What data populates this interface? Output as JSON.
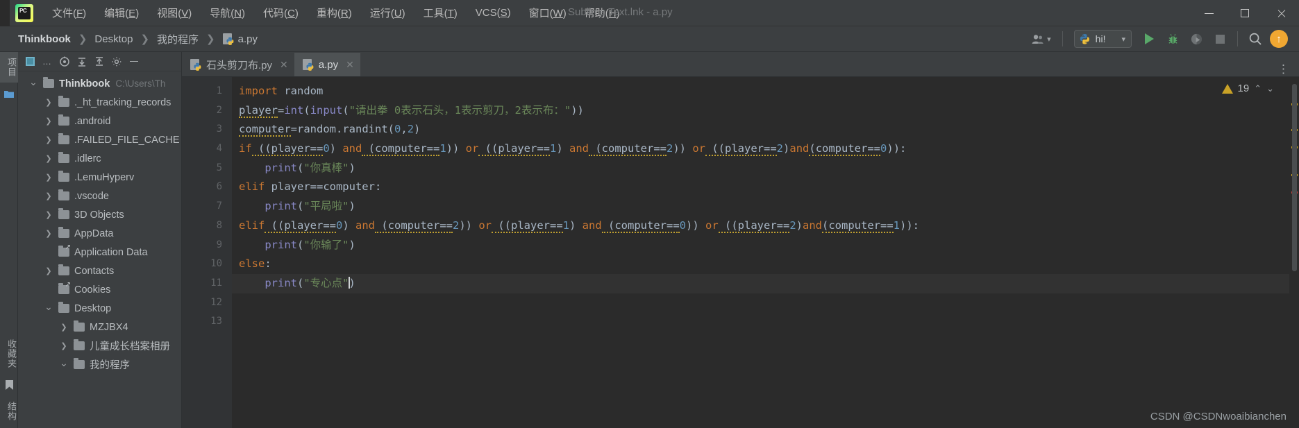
{
  "window": {
    "title": "Sublime Text.lnk - a.py",
    "app_icon": "pycharm-logo",
    "controls": {
      "minimize": "–",
      "maximize": "□",
      "close": "✕"
    }
  },
  "menubar": {
    "items": [
      {
        "label": "文件",
        "mnemonic": "F"
      },
      {
        "label": "编辑",
        "mnemonic": "E"
      },
      {
        "label": "视图",
        "mnemonic": "V"
      },
      {
        "label": "导航",
        "mnemonic": "N"
      },
      {
        "label": "代码",
        "mnemonic": "C"
      },
      {
        "label": "重构",
        "mnemonic": "R"
      },
      {
        "label": "运行",
        "mnemonic": "U"
      },
      {
        "label": "工具",
        "mnemonic": "T"
      },
      {
        "label": "VCS",
        "mnemonic": "S"
      },
      {
        "label": "窗口",
        "mnemonic": "W"
      },
      {
        "label": "帮助",
        "mnemonic": "H"
      }
    ]
  },
  "navbar": {
    "breadcrumb": [
      {
        "label": "Thinkbook",
        "root": true
      },
      {
        "label": "Desktop",
        "root": false
      },
      {
        "label": "我的程序",
        "root": false
      },
      {
        "label": "a.py",
        "root": false,
        "icon": "python-file-icon"
      }
    ],
    "separator": "❯",
    "user_icon": "user-avatar-icon",
    "user_chevron": "▾",
    "run_config": {
      "label": "hi!",
      "icon": "python-icon",
      "chevron": "▾"
    },
    "actions": [
      {
        "name": "run-button",
        "icon": "play-icon"
      },
      {
        "name": "debug-button",
        "icon": "bug-icon"
      },
      {
        "name": "coverage-button",
        "icon": "coverage-icon"
      },
      {
        "name": "stop-button",
        "icon": "stop-icon"
      },
      {
        "name": "search-button",
        "icon": "search-icon"
      },
      {
        "name": "update-button",
        "icon": "arrow-up-icon"
      }
    ]
  },
  "toolstrip": {
    "top_label": "项目",
    "bottom_labels": [
      "收藏夹",
      "结构"
    ],
    "icons": [
      "project-icon",
      "bookmark-icon"
    ]
  },
  "project_panel": {
    "toolbar": [
      {
        "name": "project-view-selector",
        "icon": "square-icon"
      },
      {
        "name": "view-options",
        "icon": "ellipsis-icon"
      },
      {
        "name": "locate-icon",
        "icon": "target-icon"
      },
      {
        "name": "expand-all-icon",
        "icon": "expand-icon"
      },
      {
        "name": "collapse-all-icon",
        "icon": "collapse-icon"
      },
      {
        "name": "settings-icon",
        "icon": "gear-icon"
      },
      {
        "name": "hide-panel-icon",
        "icon": "minus-icon"
      }
    ],
    "tree": [
      {
        "label": "Thinkbook",
        "path": "C:\\Users\\Th",
        "indent": 0,
        "twisty": "expanded",
        "bold": true,
        "link": false
      },
      {
        "label": "._ht_tracking_records",
        "indent": 1,
        "twisty": "collapsed",
        "bold": false,
        "link": false
      },
      {
        "label": ".android",
        "indent": 1,
        "twisty": "collapsed",
        "bold": false,
        "link": false
      },
      {
        "label": ".FAILED_FILE_CACHE",
        "indent": 1,
        "twisty": "collapsed",
        "bold": false,
        "link": false
      },
      {
        "label": ".idlerc",
        "indent": 1,
        "twisty": "collapsed",
        "bold": false,
        "link": false
      },
      {
        "label": ".LemuHyperv",
        "indent": 1,
        "twisty": "collapsed",
        "bold": false,
        "link": false
      },
      {
        "label": ".vscode",
        "indent": 1,
        "twisty": "collapsed",
        "bold": false,
        "link": false
      },
      {
        "label": "3D Objects",
        "indent": 1,
        "twisty": "collapsed",
        "bold": false,
        "link": false
      },
      {
        "label": "AppData",
        "indent": 1,
        "twisty": "collapsed",
        "bold": false,
        "link": false
      },
      {
        "label": "Application Data",
        "indent": 1,
        "twisty": "none",
        "bold": false,
        "link": true
      },
      {
        "label": "Contacts",
        "indent": 1,
        "twisty": "collapsed",
        "bold": false,
        "link": false
      },
      {
        "label": "Cookies",
        "indent": 1,
        "twisty": "none",
        "bold": false,
        "link": true
      },
      {
        "label": "Desktop",
        "indent": 1,
        "twisty": "expanded",
        "bold": false,
        "link": false
      },
      {
        "label": "MZJBX4",
        "indent": 2,
        "twisty": "collapsed",
        "bold": false,
        "link": false
      },
      {
        "label": "儿童成长档案相册",
        "indent": 2,
        "twisty": "collapsed",
        "bold": false,
        "link": false
      },
      {
        "label": "我的程序",
        "indent": 2,
        "twisty": "expanded",
        "bold": false,
        "link": false
      }
    ]
  },
  "tabs": {
    "items": [
      {
        "label": "石头剪刀布.py",
        "active": false,
        "icon": "python-file-icon",
        "close": "✕"
      },
      {
        "label": "a.py",
        "active": true,
        "icon": "python-file-icon",
        "close": "✕"
      }
    ],
    "overflow_icon": "more-vertical-icon"
  },
  "editor": {
    "line_numbers": [
      "1",
      "2",
      "3",
      "4",
      "5",
      "6",
      "7",
      "8",
      "9",
      "10",
      "11",
      "12",
      "13"
    ],
    "caret_line": 11,
    "inspection": {
      "count": "19",
      "icon": "warning-triangle-icon",
      "up": "⌃",
      "down": "⌄"
    },
    "lines": [
      {
        "n": 1,
        "tokens": [
          {
            "t": "import",
            "c": "k-kw"
          },
          {
            "t": " random",
            "c": "k-id"
          }
        ]
      },
      {
        "n": 2,
        "tokens": [
          {
            "t": "player",
            "c": "k-id"
          },
          {
            "t": "=",
            "c": "k-id"
          },
          {
            "t": "int",
            "c": "k-fn"
          },
          {
            "t": "(",
            "c": "k-id"
          },
          {
            "t": "input",
            "c": "k-fn"
          },
          {
            "t": "(",
            "c": "k-id"
          },
          {
            "t": "\"请出拳 0表示石头，1表示剪刀，2表示布：\"",
            "c": "k-str"
          },
          {
            "t": "))",
            "c": "k-id"
          }
        ]
      },
      {
        "n": 3,
        "tokens": [
          {
            "t": "computer",
            "c": "k-id"
          },
          {
            "t": "=",
            "c": "k-id"
          },
          {
            "t": "random",
            "c": "k-id"
          },
          {
            "t": ".randint(",
            "c": "k-id"
          },
          {
            "t": "0",
            "c": "k-num"
          },
          {
            "t": ",",
            "c": "k-id"
          },
          {
            "t": "2",
            "c": "k-num"
          },
          {
            "t": ")",
            "c": "k-id"
          }
        ]
      },
      {
        "n": 4,
        "tokens": [
          {
            "t": "if",
            "c": "k-kw"
          },
          {
            "t": " ((player==",
            "c": "k-id"
          },
          {
            "t": "0",
            "c": "k-num"
          },
          {
            "t": ") ",
            "c": "k-id"
          },
          {
            "t": "and",
            "c": "k-kw"
          },
          {
            "t": " (computer==",
            "c": "k-id"
          },
          {
            "t": "1",
            "c": "k-num"
          },
          {
            "t": ")) ",
            "c": "k-id"
          },
          {
            "t": "or",
            "c": "k-kw"
          },
          {
            "t": " ((player==",
            "c": "k-id"
          },
          {
            "t": "1",
            "c": "k-num"
          },
          {
            "t": ") ",
            "c": "k-id"
          },
          {
            "t": "and",
            "c": "k-kw"
          },
          {
            "t": " (computer==",
            "c": "k-id"
          },
          {
            "t": "2",
            "c": "k-num"
          },
          {
            "t": ")) ",
            "c": "k-id"
          },
          {
            "t": "or",
            "c": "k-kw"
          },
          {
            "t": " ((player==",
            "c": "k-id"
          },
          {
            "t": "2",
            "c": "k-num"
          },
          {
            "t": ")",
            "c": "k-id"
          },
          {
            "t": "and",
            "c": "k-kw"
          },
          {
            "t": "(computer==",
            "c": "k-id"
          },
          {
            "t": "0",
            "c": "k-num"
          },
          {
            "t": ")):",
            "c": "k-id"
          }
        ]
      },
      {
        "n": 5,
        "tokens": [
          {
            "t": "    ",
            "c": "k-id"
          },
          {
            "t": "print",
            "c": "k-fn"
          },
          {
            "t": "(",
            "c": "k-id"
          },
          {
            "t": "\"你真棒\"",
            "c": "k-str"
          },
          {
            "t": ")",
            "c": "k-id"
          }
        ]
      },
      {
        "n": 6,
        "tokens": [
          {
            "t": "elif",
            "c": "k-kw"
          },
          {
            "t": " player==computer:",
            "c": "k-id"
          }
        ]
      },
      {
        "n": 7,
        "tokens": [
          {
            "t": "    ",
            "c": "k-id"
          },
          {
            "t": "print",
            "c": "k-fn"
          },
          {
            "t": "(",
            "c": "k-id"
          },
          {
            "t": "\"平局啦\"",
            "c": "k-str"
          },
          {
            "t": ")",
            "c": "k-id"
          }
        ]
      },
      {
        "n": 8,
        "tokens": [
          {
            "t": "elif",
            "c": "k-kw"
          },
          {
            "t": " ((player==",
            "c": "k-id"
          },
          {
            "t": "0",
            "c": "k-num"
          },
          {
            "t": ") ",
            "c": "k-id"
          },
          {
            "t": "and",
            "c": "k-kw"
          },
          {
            "t": " (computer==",
            "c": "k-id"
          },
          {
            "t": "2",
            "c": "k-num"
          },
          {
            "t": ")) ",
            "c": "k-id"
          },
          {
            "t": "or",
            "c": "k-kw"
          },
          {
            "t": " ((player==",
            "c": "k-id"
          },
          {
            "t": "1",
            "c": "k-num"
          },
          {
            "t": ") ",
            "c": "k-id"
          },
          {
            "t": "and",
            "c": "k-kw"
          },
          {
            "t": " (computer==",
            "c": "k-id"
          },
          {
            "t": "0",
            "c": "k-num"
          },
          {
            "t": ")) ",
            "c": "k-id"
          },
          {
            "t": "or",
            "c": "k-kw"
          },
          {
            "t": " ((player==",
            "c": "k-id"
          },
          {
            "t": "2",
            "c": "k-num"
          },
          {
            "t": ")",
            "c": "k-id"
          },
          {
            "t": "and",
            "c": "k-kw"
          },
          {
            "t": "(computer==",
            "c": "k-id"
          },
          {
            "t": "1",
            "c": "k-num"
          },
          {
            "t": ")):",
            "c": "k-id"
          }
        ]
      },
      {
        "n": 9,
        "tokens": [
          {
            "t": "    ",
            "c": "k-id"
          },
          {
            "t": "print",
            "c": "k-fn"
          },
          {
            "t": "(",
            "c": "k-id"
          },
          {
            "t": "\"你输了\"",
            "c": "k-str"
          },
          {
            "t": ")",
            "c": "k-id"
          }
        ]
      },
      {
        "n": 10,
        "tokens": [
          {
            "t": "else",
            "c": "k-kw"
          },
          {
            "t": ":",
            "c": "k-id"
          }
        ]
      },
      {
        "n": 11,
        "tokens": [
          {
            "t": "    ",
            "c": "k-id"
          },
          {
            "t": "print",
            "c": "k-fn"
          },
          {
            "t": "(",
            "c": "k-id"
          },
          {
            "t": "\"专心点\"",
            "c": "k-str"
          },
          {
            "t": ")",
            "c": "k-id"
          }
        ]
      },
      {
        "n": 12,
        "tokens": []
      },
      {
        "n": 13,
        "tokens": []
      }
    ]
  },
  "watermark": "CSDN @CSDNwoaibianchen"
}
